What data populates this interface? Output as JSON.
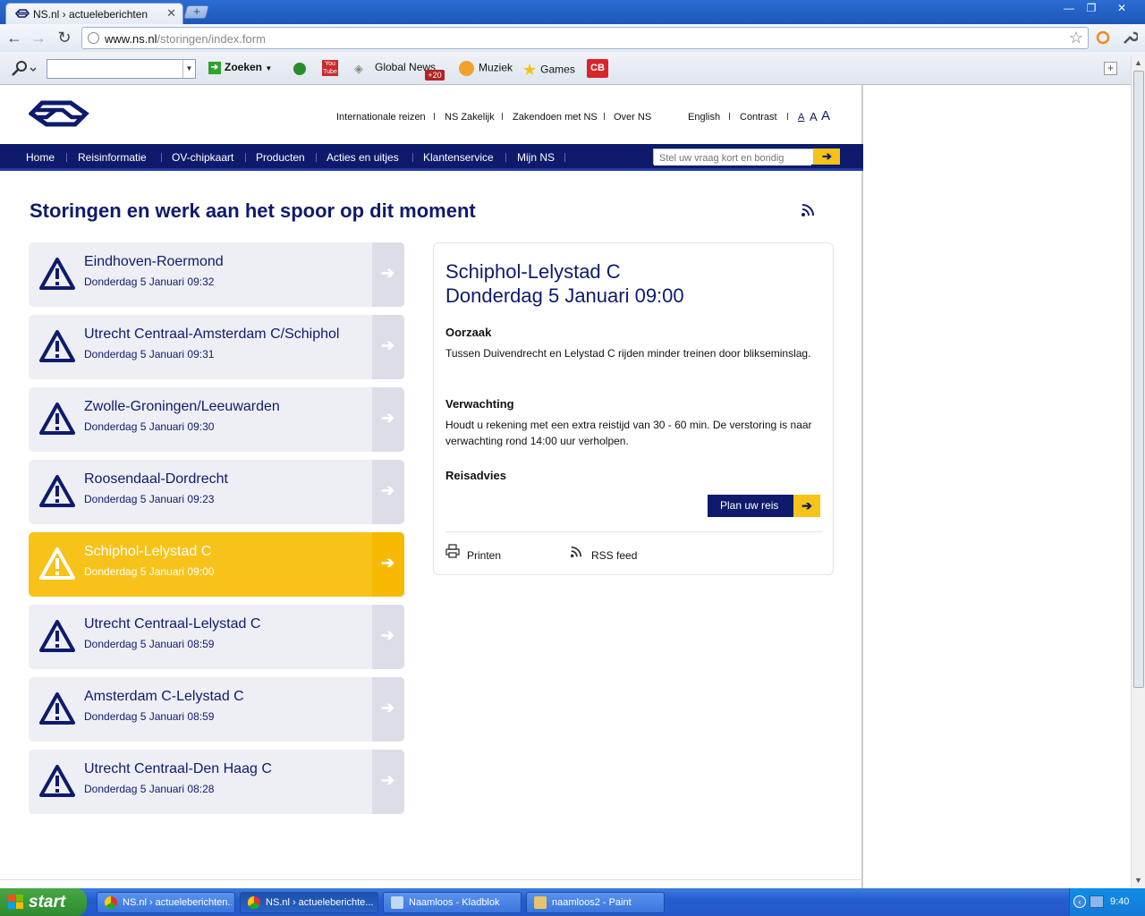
{
  "browser": {
    "tab_title": "NS.nl › actueleberichten",
    "url_host": "www.ns.nl",
    "url_path": "/storingen/index.form"
  },
  "bookmarks": {
    "search_label": "Zoeken",
    "global_news": "Global News",
    "global_news_badge": "+20",
    "muziek": "Muziek",
    "games": "Games"
  },
  "site": {
    "toplinks": [
      "Internationale reizen",
      "NS Zakelijk",
      "Zakendoen met NS",
      "Over NS",
      "English",
      "Contrast"
    ],
    "fontsizes": [
      "A",
      "A",
      "A"
    ],
    "nav": [
      "Home",
      "Reisinformatie",
      "OV-chipkaart",
      "Producten",
      "Acties en uitjes",
      "Klantenservice",
      "Mijn NS"
    ],
    "search_placeholder": "Stel uw vraag kort en bondig"
  },
  "page": {
    "title": "Storingen en werk aan het spoor op dit moment"
  },
  "disruptions": [
    {
      "route": "Eindhoven-Roermond",
      "when": "Donderdag 5 Januari 09:32"
    },
    {
      "route": "Utrecht Centraal-Amsterdam C/Schiphol",
      "when": "Donderdag 5 Januari 09:31"
    },
    {
      "route": "Zwolle-Groningen/Leeuwarden",
      "when": "Donderdag 5 Januari 09:30"
    },
    {
      "route": "Roosendaal-Dordrecht",
      "when": "Donderdag 5 Januari 09:23"
    },
    {
      "route": "Schiphol-Lelystad C",
      "when": "Donderdag 5 Januari 09:00"
    },
    {
      "route": "Utrecht Centraal-Lelystad C",
      "when": "Donderdag 5 Januari 08:59"
    },
    {
      "route": "Amsterdam C-Lelystad C",
      "when": "Donderdag 5 Januari 08:59"
    },
    {
      "route": "Utrecht Centraal-Den Haag C",
      "when": "Donderdag 5 Januari 08:28"
    }
  ],
  "detail": {
    "title_line1": "Schiphol-Lelystad C",
    "title_line2": "Donderdag 5 Januari 09:00",
    "oorzaak_heading": "Oorzaak",
    "oorzaak_text": "Tussen Duivendrecht en Lelystad C rijden minder treinen door blikseminslag.",
    "verwachting_heading": "Verwachting",
    "verwachting_text": "Houdt u rekening met een extra reistijd van 30 - 60 min. De verstoring is naar verwachting rond 14:00 uur verholpen.",
    "reisadvies_heading": "Reisadvies",
    "plan_button": "Plan uw reis",
    "print_label": "Printen",
    "rss_label": "RSS feed"
  },
  "taskbar": {
    "start": "start",
    "tasks": [
      "NS.nl › actueleberichten...",
      "NS.nl › actueleberichte...",
      "Naamloos - Kladblok",
      "naamloos2 - Paint"
    ],
    "clock": "9:40"
  },
  "colors": {
    "ns_blue": "#0e1b6c",
    "ns_yellow": "#f7c21a"
  }
}
